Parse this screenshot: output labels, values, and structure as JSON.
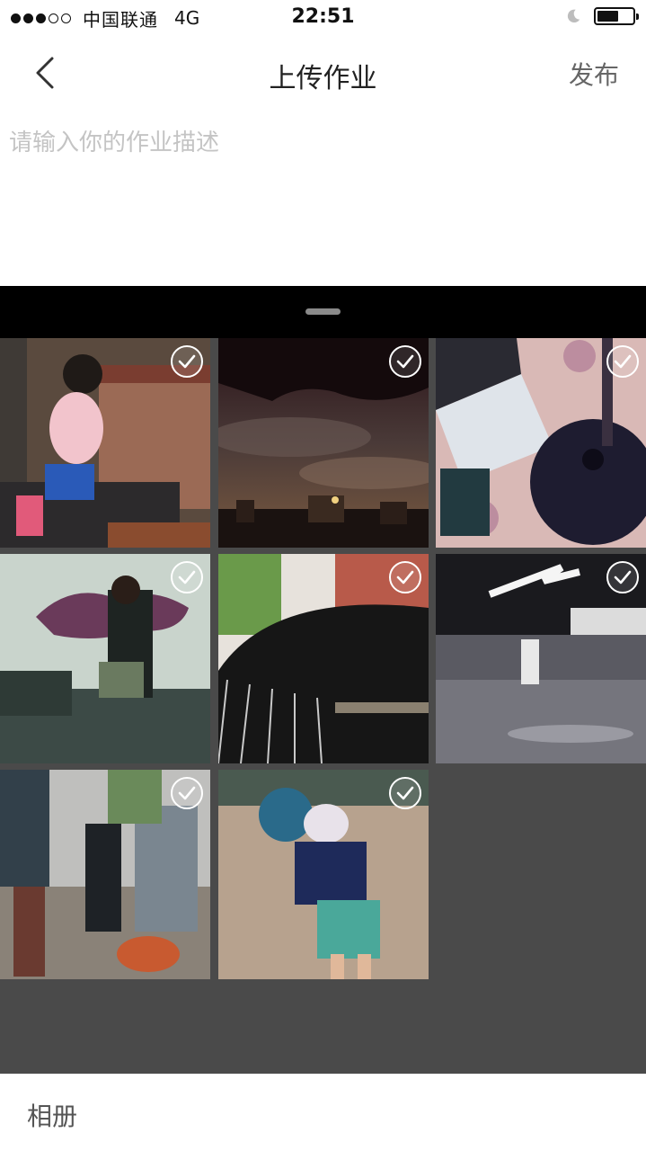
{
  "status_bar": {
    "carrier": "中国联通",
    "network": "4G",
    "time": "22:51",
    "signal_bars_filled": 3,
    "signal_bars_total": 5,
    "battery_level": 0.6
  },
  "nav": {
    "title": "上传作业",
    "publish_label": "发布",
    "back_icon": "chevron-left-icon"
  },
  "description": {
    "placeholder": "请输入你的作业描述",
    "value": ""
  },
  "picker": {
    "photos": [
      {
        "subject": "child-by-wall",
        "selected": true
      },
      {
        "subject": "night-city-sky",
        "selected": true
      },
      {
        "subject": "laptop-and-guitar",
        "selected": true
      },
      {
        "subject": "graffiti-room",
        "selected": true
      },
      {
        "subject": "guitar-closeup",
        "selected": true
      },
      {
        "subject": "empty-hall",
        "selected": true
      },
      {
        "subject": "hikers-group",
        "selected": true
      },
      {
        "subject": "person-on-pebbles",
        "selected": true
      }
    ]
  },
  "bottom_bar": {
    "album_label": "相册"
  },
  "colors": {
    "sheet_background": "#4a4a4a",
    "sheet_header": "#000000",
    "placeholder": "#c4c4c4",
    "check_ring": "#ffffff"
  }
}
